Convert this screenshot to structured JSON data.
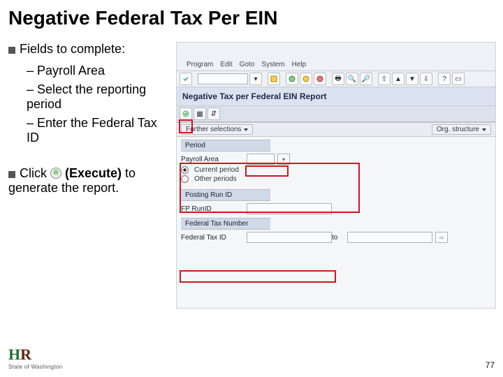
{
  "slide": {
    "title": "Negative Federal Tax Per EIN",
    "fields_label": "Fields to complete:",
    "bullets": {
      "b1": "Payroll Area",
      "b2": "Select the reporting period",
      "b3": "Enter the Federal Tax ID"
    },
    "click_prefix": "Click ",
    "click_execute": "(Execute)",
    "click_suffix": " to generate the report.",
    "page_number": "77",
    "logo": {
      "h": "H",
      "r": "R",
      "sub": "State of Washington"
    }
  },
  "sap": {
    "menu": {
      "program": "Program",
      "edit": "Edit",
      "goto": "Goto",
      "system": "System",
      "help": "Help"
    },
    "report_title": "Negative Tax per Federal EIN Report",
    "buttons": {
      "further_selections": "Further selections",
      "org_structure": "Org. structure"
    },
    "groups": {
      "period": {
        "header": "Period",
        "payroll_area_label": "Payroll Area",
        "current_period": "Current period",
        "other_periods": "Other periods"
      },
      "posting": {
        "header": "Posting Run ID",
        "fp_runid": "FP RunID"
      },
      "fedtax": {
        "header": "Federal Tax Number",
        "fed_tax_id": "Federal Tax ID",
        "to": "to"
      }
    }
  }
}
